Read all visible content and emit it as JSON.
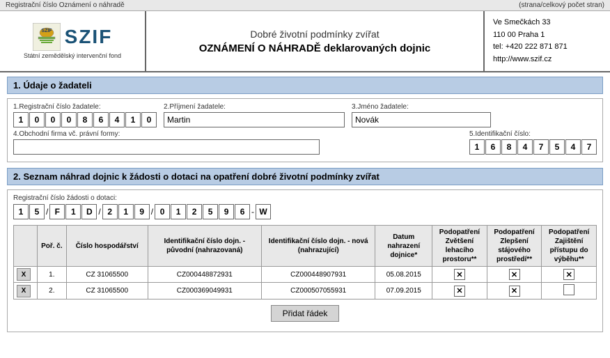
{
  "topbar": {
    "left": "Registrační číslo Oznámení o náhradě",
    "right": "(strana/celkový počet stran)"
  },
  "header": {
    "logo_text": "SZIF",
    "logo_subtitle": "Státní zemědělský intervenční fond",
    "center_title": "Dobré životní podmínky zvířat",
    "center_subtitle": "OZNÁMENÍ O NÁHRADĚ deklarovaných dojnic",
    "contact_line1": "Ve Smečkách 33",
    "contact_line2": "110 00 Praha 1",
    "contact_line3": "tel: +420 222 871 871",
    "contact_line4": "http://www.szif.cz"
  },
  "section1": {
    "title": "1. Údaje o žadateli",
    "field1_label": "1.Registrační číslo žadatele:",
    "field1_digits": [
      "1",
      "0",
      "0",
      "0",
      "8",
      "6",
      "4",
      "1",
      "0"
    ],
    "field2_label": "2.Příjmení žadatele:",
    "field2_value": "Martin",
    "field3_label": "3.Jméno žadatele:",
    "field3_value": "Novák",
    "field4_label": "4.Obchodní firma vč. právní formy:",
    "field4_value": "",
    "field5_label": "5.Identifikační číslo:",
    "field5_digits": [
      "1",
      "6",
      "8",
      "4",
      "7",
      "5",
      "4",
      "7"
    ]
  },
  "section2": {
    "title": "2. Seznam náhrad dojnic k žádosti o dotaci na opatření dobré životní podmínky zvířat",
    "reg_label": "Registrační číslo žádosti o dotaci:",
    "reg_digits": [
      "1",
      "5",
      "F",
      "1",
      "D",
      "2",
      "1",
      "9",
      "0",
      "1",
      "2",
      "5",
      "9",
      "6",
      "W"
    ],
    "reg_seps": [
      "/",
      "",
      "/",
      "",
      "",
      "/",
      "",
      "",
      "",
      "",
      "/",
      "",
      "",
      "",
      ""
    ],
    "table": {
      "headers": [
        "",
        "Poř. č.",
        "Číslo hospodářství",
        "Identifikační číslo dojn. - původní (nahrazovaná)",
        "Identifikační číslo dojn. - nová (nahrazující)",
        "Datum nahrazení dojnice*",
        "Podopatření Zvětšení lehacího prostoru**",
        "Podopatření Zlepšení stájového prostředí**",
        "Podopatření Zajištění přístupu do výběhu**"
      ],
      "rows": [
        {
          "del": "X",
          "por": "1.",
          "hospodatstvi": "CZ 31065500",
          "id_puvodni": "CZ000448872931",
          "id_nova": "CZ000448907931",
          "datum": "05.08.2015",
          "zvetseni": "x",
          "zlepseni": "x",
          "zajisteni": "x"
        },
        {
          "del": "X",
          "por": "2.",
          "hospodatstvi": "CZ 31065500",
          "id_puvodni": "CZ000369049931",
          "id_nova": "CZ000507055931",
          "datum": "07.09.2015",
          "zvetseni": "x",
          "zlepseni": "x",
          "zajisteni": ""
        }
      ]
    },
    "add_row_label": "Přidat řádek"
  }
}
